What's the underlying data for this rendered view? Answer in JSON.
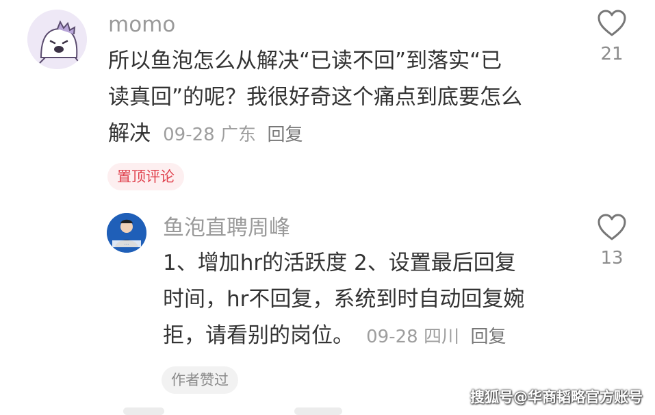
{
  "comment": {
    "username": "momo",
    "text": "所以鱼泡怎么从解决“已读不回”到落实“已读真回”的呢？我很好奇这个痛点到底要怎么解决",
    "line1": "所以鱼泡怎么从解决“已读不回”到落实“已",
    "line2": "读真回”的呢？我很好奇这个痛点到底要怎么",
    "line3": "解决",
    "date": "09-28",
    "location": "广东",
    "reply_label": "回复",
    "like_count": "21",
    "pinned_label": "置顶评论"
  },
  "reply": {
    "username": "鱼泡直聘周峰",
    "line1": "1、增加hr的活跃度 2、设置最后回复",
    "line2": "时间，hr不回复，系统到时自动回复婉",
    "line3": "拒，请看别的岗位。",
    "date": "09-28",
    "location": "四川",
    "reply_label": "回复",
    "like_count": "13",
    "author_liked_label": "作者赞过"
  },
  "watermark": "搜狐号@华商韬略官方账号",
  "colors": {
    "pinned_badge_bg": "#fdeff0",
    "pinned_badge_text": "#e0434f",
    "secondary_text": "#9a9a9a",
    "primary_text": "#333333"
  },
  "icons": {
    "like": "heart-outline-icon",
    "avatar_top": "purple-dinosaur-avatar",
    "avatar_reply": "person-avatar"
  }
}
